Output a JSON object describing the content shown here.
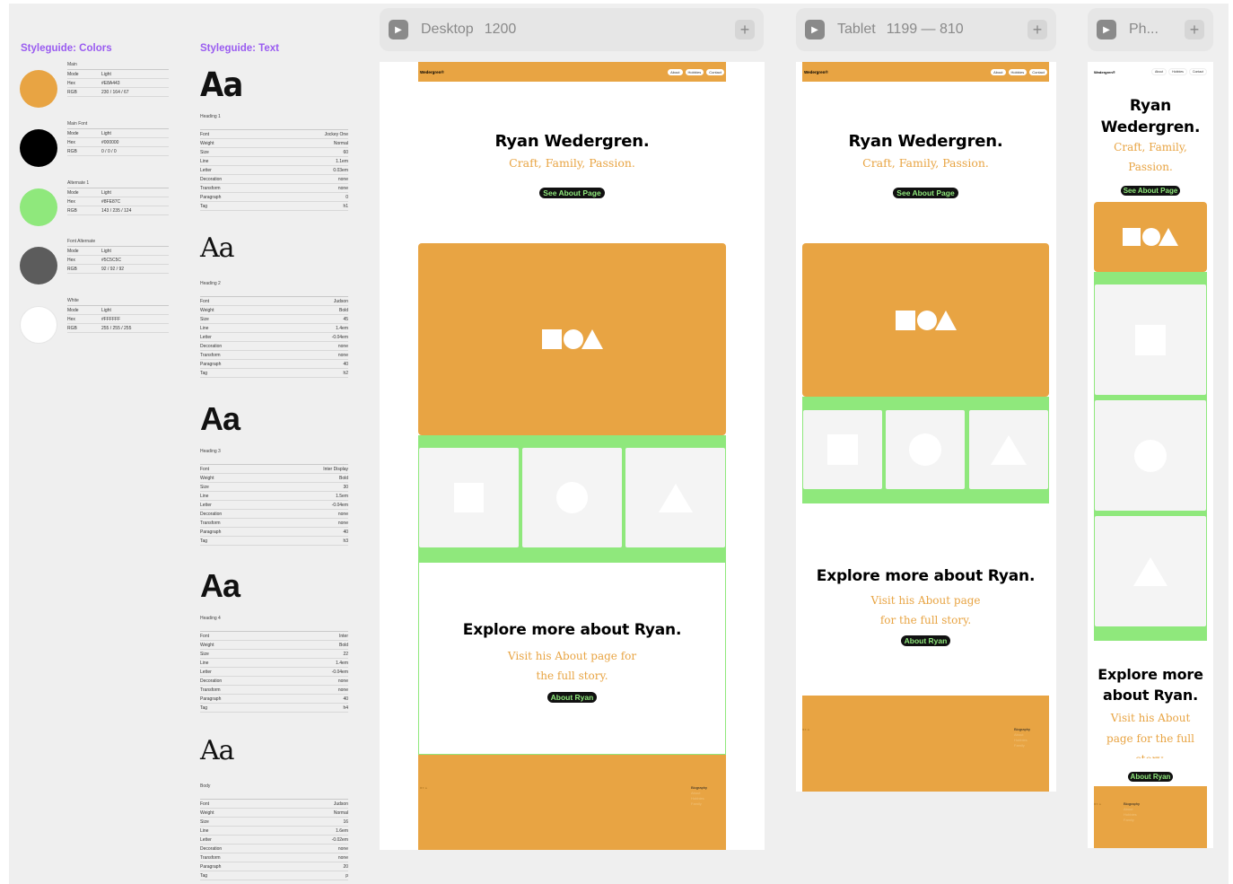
{
  "colors": {
    "orange": "#E8A443",
    "black": "#000000",
    "green": "#8FE87C",
    "grey": "#5C5C5C",
    "white": "#FFFFFF",
    "accent_purple": "#9A5CF0"
  },
  "styleguide_colors": {
    "title": "Styleguide: Colors",
    "swatches": [
      {
        "name": "Main",
        "color": "#E8A443",
        "mode": "Light",
        "hex": "#E8A443",
        "rgb": "230 / 164 / 67"
      },
      {
        "name": "Main Font",
        "color": "#000000",
        "mode": "Light",
        "hex": "#000000",
        "rgb": "0 / 0 / 0"
      },
      {
        "name": "Alternate 1",
        "color": "#8FE87C",
        "mode": "Light",
        "hex": "#8FE87C",
        "rgb": "143 / 235 / 124"
      },
      {
        "name": "Font Alternate",
        "color": "#5C5C5C",
        "mode": "Light",
        "hex": "#5C5C5C",
        "rgb": "92 / 92 / 92"
      },
      {
        "name": "White",
        "color": "#FFFFFF",
        "mode": "Light",
        "hex": "#FFFFFF",
        "rgb": "255 / 255 / 255"
      }
    ],
    "row_labels": {
      "mode": "Mode",
      "hex": "Hex",
      "rgb": "RGB"
    }
  },
  "styleguide_text": {
    "title": "Styleguide: Text",
    "sample": "Aa",
    "row_labels": [
      "Font",
      "Weight",
      "Size",
      "Line",
      "Letter",
      "Decoration",
      "Transform",
      "Paragraph",
      "Tag"
    ],
    "styles": [
      {
        "name": "Heading 1",
        "values": [
          "Jockey One",
          "Normal",
          "60",
          "1.1em",
          "0.03em",
          "none",
          "none",
          "0",
          "h1"
        ]
      },
      {
        "name": "Heading 2",
        "values": [
          "Judson",
          "Bold",
          "45",
          "1.4em",
          "-0.04em",
          "none",
          "none",
          "40",
          "h2"
        ]
      },
      {
        "name": "Heading 3",
        "values": [
          "Inter Display",
          "Bold",
          "30",
          "1.5em",
          "-0.04em",
          "none",
          "none",
          "40",
          "h3"
        ]
      },
      {
        "name": "Heading 4",
        "values": [
          "Inter",
          "Bold",
          "22",
          "1.4em",
          "-0.04em",
          "none",
          "none",
          "40",
          "h4"
        ]
      },
      {
        "name": "Body",
        "values": [
          "Judson",
          "Normal",
          "16",
          "1.6em",
          "-0.02em",
          "none",
          "none",
          "20",
          "p"
        ]
      }
    ]
  },
  "breakpoints": [
    {
      "name": "Desktop",
      "size": "1200"
    },
    {
      "name": "Tablet",
      "size": "1199 — 810"
    },
    {
      "name": "Ph...",
      "size": ""
    }
  ],
  "site": {
    "logo": "Wedergren®",
    "nav": [
      "About",
      "Hobbies",
      "Contact"
    ],
    "hero_title": "Ryan Wedergren.",
    "hero_title_phone_line1": "Ryan",
    "hero_title_phone_line2": "Wedergren.",
    "hero_subtitle": "Craft, Family, Passion.",
    "hero_subtitle_phone_line1": "Craft, Family,",
    "hero_subtitle_phone_line2": "Passion.",
    "hero_button": "See About Page",
    "explore_title": "Explore more about Ryan.",
    "explore_title_phone_line1": "Explore more",
    "explore_title_phone_line2": "about Ryan.",
    "explore_sub_desktop_line1": "Visit his About page for",
    "explore_sub_desktop_line2": "the full story.",
    "explore_sub_tablet_line1": "Visit his About page",
    "explore_sub_tablet_line2": "for the full story.",
    "explore_sub_phone_line1": "Visit his About",
    "explore_sub_phone_line2": "page for the full",
    "explore_sub_phone_line3": "story.",
    "explore_button": "About Ryan",
    "footer_logo": "■●▲",
    "footer_heading": "Biography",
    "footer_links": [
      "About",
      "Hobbies",
      "Family"
    ]
  }
}
